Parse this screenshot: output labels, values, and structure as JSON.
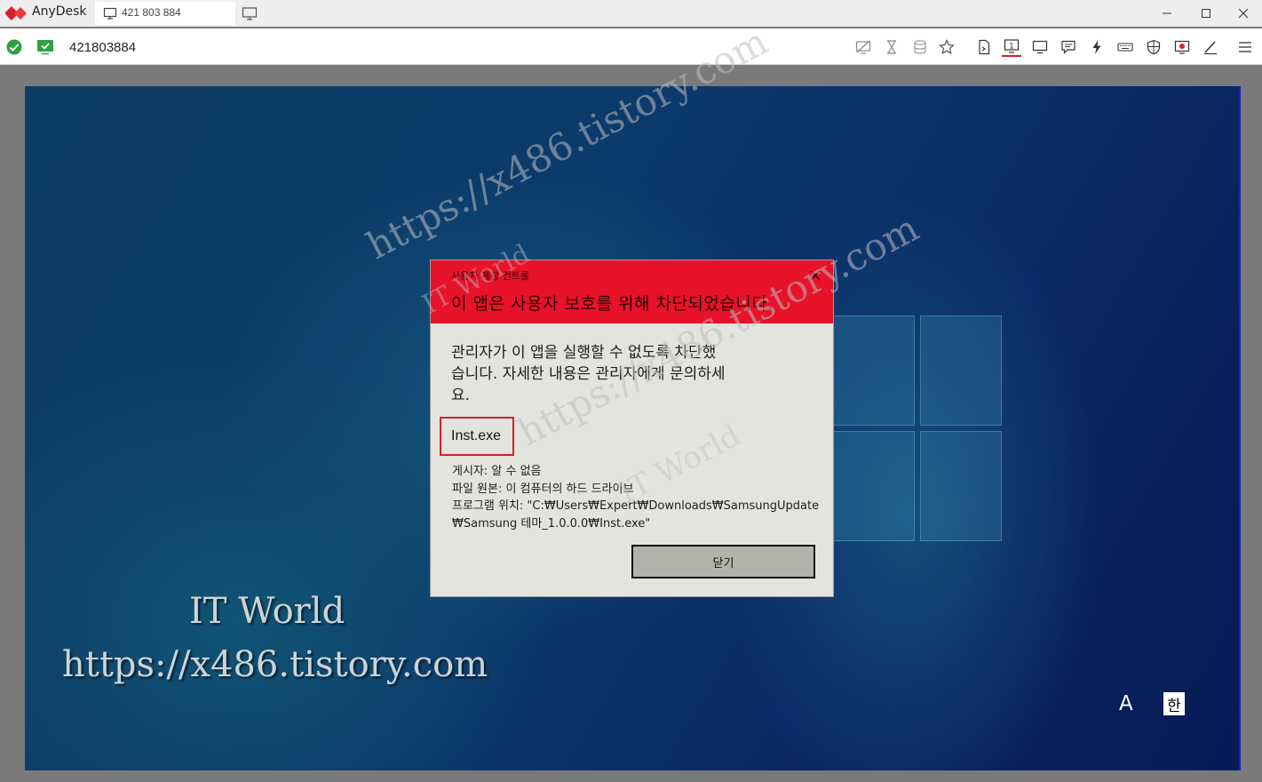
{
  "app": {
    "name": "AnyDesk",
    "brand_color": "#d2232a"
  },
  "tab": {
    "label": "421 803 884",
    "icon": "monitor-icon"
  },
  "address": {
    "value": "421803884"
  },
  "toolbar": {
    "icons": [
      "view-hidden-icon",
      "hourglass-icon",
      "database-icon",
      "star-icon",
      "file-transfer-icon",
      "display-1-icon",
      "monitor-icon",
      "chat-icon",
      "lightning-icon",
      "keyboard-icon",
      "shield-icon",
      "record-icon",
      "pen-icon",
      "menu-icon"
    ]
  },
  "watermark": {
    "line1": "IT World",
    "line2": "https://x486.tistory.com"
  },
  "ime": {
    "mode": "A",
    "lang": "한"
  },
  "dialog": {
    "caption": "사용자 계정 컨트롤",
    "title": "이 앱은 사용자 보호를 위해 차단되었습니다.",
    "message_line1": "관리자가 이 앱을 실행할 수 없도록 차단했",
    "message_line2": "습니다. 자세한 내용은 관리자에게 문의하세",
    "message_line3": "요.",
    "file_name": "Inst.exe",
    "publisher": "게시자: 알 수 없음",
    "origin": "파일 원본: 이 컴퓨터의 하드 드라이브",
    "location_line1": "프로그램 위치: \"C:₩Users₩Expert₩Downloads₩SamsungUpdate",
    "location_line2": "₩Samsung 테마_1.0.0.0₩Inst.exe\"",
    "close_label": "닫기",
    "header_color": "#e8122a"
  }
}
